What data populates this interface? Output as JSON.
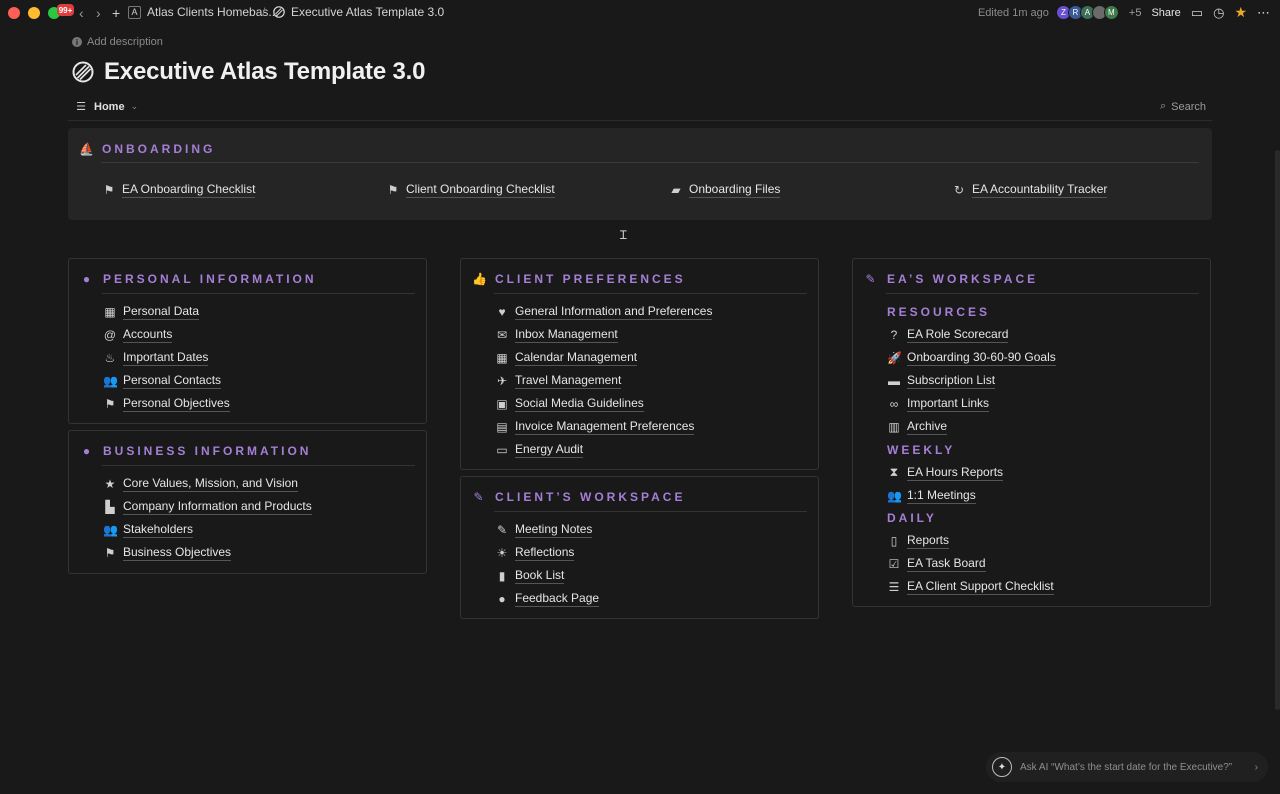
{
  "topbar": {
    "notification_count": "99+",
    "breadcrumb_parent": "Atlas Clients Homebas...",
    "breadcrumb_parent_initial": "A",
    "breadcrumb_separator": "/",
    "breadcrumb_current": "Executive Atlas Template 3.0",
    "edited": "Edited 1m ago",
    "avatars": [
      {
        "initial": "Z",
        "color": "#6b4fd1"
      },
      {
        "initial": "R",
        "color": "#3a5a9a"
      },
      {
        "initial": "A",
        "color": "#3d6e58"
      },
      {
        "initial": "",
        "color": "#6a6a6a"
      },
      {
        "initial": "M",
        "color": "#3f7a4a"
      }
    ],
    "more_count": "+5",
    "share_label": "Share"
  },
  "header": {
    "add_description": "Add description",
    "title": "Executive Atlas Template 3.0",
    "view_label": "Home",
    "search_label": "Search"
  },
  "onboarding": {
    "heading": "ONBOARDING",
    "items": [
      {
        "label": "EA Onboarding Checklist",
        "icon": "flag-icon"
      },
      {
        "label": "Client Onboarding Checklist",
        "icon": "flag-icon"
      },
      {
        "label": "Onboarding Files",
        "icon": "folder-icon"
      },
      {
        "label": "EA Accountability Tracker",
        "icon": "cycle-icon"
      }
    ]
  },
  "personal": {
    "heading": "PERSONAL INFORMATION",
    "items": [
      {
        "label": "Personal Data"
      },
      {
        "label": "Accounts"
      },
      {
        "label": "Important Dates"
      },
      {
        "label": "Personal Contacts"
      },
      {
        "label": "Personal Objectives"
      }
    ]
  },
  "business": {
    "heading": "BUSINESS INFORMATION",
    "items": [
      {
        "label": "Core Values, Mission, and Vision"
      },
      {
        "label": "Company Information and Products"
      },
      {
        "label": "Stakeholders"
      },
      {
        "label": "Business Objectives"
      }
    ]
  },
  "client_prefs": {
    "heading": "CLIENT PREFERENCES",
    "items": [
      {
        "label": "General Information and Preferences"
      },
      {
        "label": "Inbox Management"
      },
      {
        "label": "Calendar Management"
      },
      {
        "label": "Travel Management"
      },
      {
        "label": "Social Media Guidelines"
      },
      {
        "label": "Invoice Management Preferences"
      },
      {
        "label": "Energy Audit"
      }
    ]
  },
  "client_workspace": {
    "heading": "CLIENT’S WORKSPACE",
    "items": [
      {
        "label": "Meeting Notes"
      },
      {
        "label": "Reflections"
      },
      {
        "label": "Book List"
      },
      {
        "label": "Feedback Page"
      }
    ]
  },
  "ea_workspace": {
    "heading": "EA’S WORKSPACE",
    "resources_heading": "RESOURCES",
    "resources": [
      {
        "label": "EA Role Scorecard"
      },
      {
        "label": "Onboarding 30-60-90 Goals"
      },
      {
        "label": "Subscription List"
      },
      {
        "label": "Important Links"
      },
      {
        "label": "Archive"
      }
    ],
    "weekly_heading": "WEEKLY",
    "weekly": [
      {
        "label": "EA Hours Reports"
      },
      {
        "label": "1:1 Meetings"
      }
    ],
    "daily_heading": "DAILY",
    "daily": [
      {
        "label": "Reports"
      },
      {
        "label": "EA Task Board"
      },
      {
        "label": "EA Client Support Checklist"
      }
    ]
  },
  "ask_ai": {
    "text": "Ask AI “What’s the start date for the Executive?”"
  },
  "colors": {
    "accent": "#a57fd6",
    "background": "#191919",
    "panel": "#252525"
  }
}
